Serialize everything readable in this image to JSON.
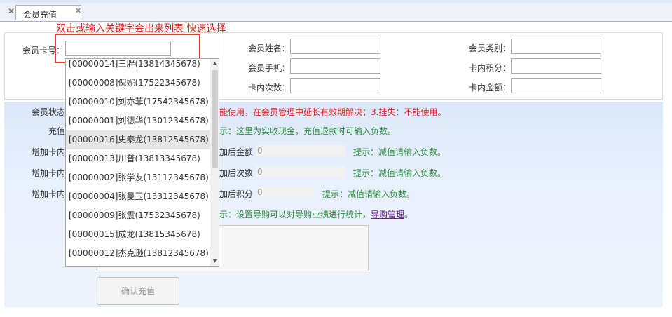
{
  "tabs": [
    {
      "label": "会员充值",
      "active": true
    }
  ],
  "annotation": {
    "text": "双击或输入关键字会出来列表 快速选择"
  },
  "header": {
    "card_no_label": "会员卡号：",
    "name_label": "会员姓名：",
    "phone_label": "会员手机：",
    "times_label": "卡内次数：",
    "category_label": "会员类别：",
    "points_label": "卡内积分：",
    "amount_label": "卡内金额："
  },
  "form": {
    "status_label": "会员状态",
    "status_hint": "能使用，在会员管理中延长有效期解决；3.挂失：不能使用。",
    "recharge_label": "充值",
    "recharge_hint": "示：这里为实收现金，充值退款时可输入负数。",
    "add_amount_label": "增加卡内",
    "after_amount_label": "加后金额",
    "after_amount_value": "0",
    "after_amount_hint": "提示：减值请输入负数。",
    "add_times_label": "增加卡内",
    "after_times_label": "加后次数",
    "after_times_value": "0",
    "after_times_hint": "提示：减值请输入负数。",
    "add_points_label": "增加卡内",
    "after_points_label": "加后积分",
    "after_points_value": "0",
    "after_points_hint": "提示：减值请输入负数。",
    "guide_hint": "示：设置导购可以对导购业绩进行统计，",
    "guide_link": "导购管理",
    "guide_tail": "。",
    "confirm_label": "确认充值"
  },
  "dropdown": {
    "items": [
      "[00000014]三胖(13814345678)",
      "[00000008]倪妮(17522345678)",
      "[00000010]刘亦菲(17542345678)",
      "[00000001]刘德华(13012345678)",
      "[00000016]史泰龙(13812545678)",
      "[00000013]川普(13813345678)",
      "[00000002]张学友(13112345678)",
      "[00000004]张曼玉(13312345678)",
      "[00000009]张震(17532345678)",
      "[00000015]成龙(13815345678)",
      "[00000012]杰克逊(13812345678)"
    ],
    "highlighted_index": 4
  },
  "colors": {
    "hint_red": "#e0231f",
    "hint_green": "#2a8b3a",
    "link_purple": "#6b1d8f",
    "section_blue": "#dbe8fa"
  }
}
